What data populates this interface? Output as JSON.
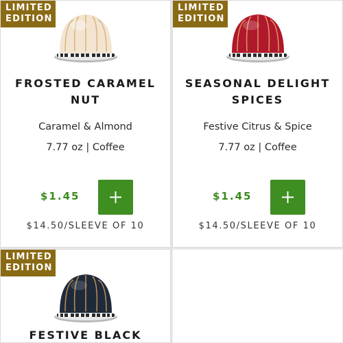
{
  "products": [
    {
      "badge_line1": "LIMITED",
      "badge_line2": "EDITION",
      "name_line1": "FROSTED CARAMEL",
      "name_line2": "NUT",
      "flavor": "Caramel & Almond",
      "size": "7.77 oz | Coffee",
      "price": "$1.45",
      "sleeve_price": "$14.50/SLEEVE OF 10",
      "add_label": "+",
      "capsule_color": "#f3e4d0",
      "stripe_color": "#caa15a"
    },
    {
      "badge_line1": "LIMITED",
      "badge_line2": "EDITION",
      "name_line1": "SEASONAL DELIGHT",
      "name_line2": "SPICES",
      "flavor": "Festive Citrus & Spice",
      "size": "7.77 oz | Coffee",
      "price": "$1.45",
      "sleeve_price": "$14.50/SLEEVE OF 10",
      "add_label": "+",
      "capsule_color": "#b0182c",
      "stripe_color": "#e8b96a"
    },
    {
      "badge_line1": "LIMITED",
      "badge_line2": "EDITION",
      "name_line1": "FESTIVE BLACK",
      "capsule_color": "#1e2a3a",
      "stripe_color": "#d9a063"
    }
  ],
  "colors": {
    "badge": "#8a6a14",
    "price": "#3b8a1e",
    "add_button": "#3e8e22"
  }
}
